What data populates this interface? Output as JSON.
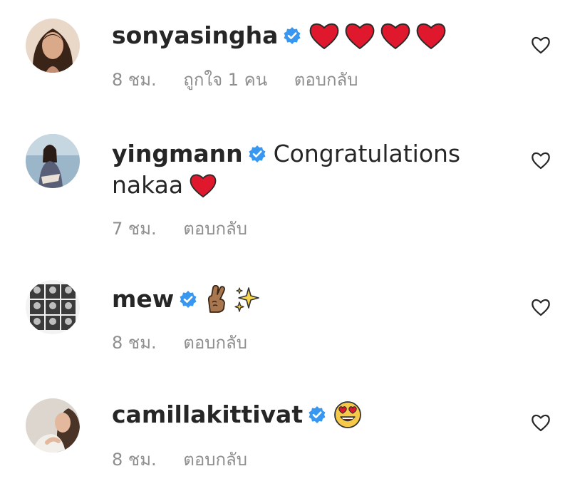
{
  "comments": [
    {
      "username": "sonyasingha",
      "text": "",
      "text_line2": "",
      "emoji_names": [
        "red-heart",
        "red-heart",
        "red-heart",
        "red-heart"
      ],
      "time": "8 ชม.",
      "likes": "ถูกใจ 1 คน",
      "reply": "ตอบกลับ"
    },
    {
      "username": "yingmann",
      "text": "Congratulations",
      "text_line2": "nakaa",
      "emoji_names": [
        "red-heart"
      ],
      "time": "7 ชม.",
      "likes": "",
      "reply": "ตอบกลับ"
    },
    {
      "username": "mew",
      "text": "",
      "text_line2": "",
      "emoji_names": [
        "crossed-fingers",
        "sparkles"
      ],
      "time": "8 ชม.",
      "likes": "",
      "reply": "ตอบกลับ"
    },
    {
      "username": "camillakittivat",
      "text": "",
      "text_line2": "",
      "emoji_names": [
        "heart-eyes-face"
      ],
      "time": "8 ชม.",
      "likes": "",
      "reply": "ตอบกลับ"
    }
  ],
  "colors": {
    "username": "#262626",
    "meta": "#8e8e8e",
    "verified": "#3897f0",
    "heart_emoji": "#e0182d"
  },
  "icons": {
    "verified": "verified-badge-icon",
    "like": "heart-outline-icon"
  }
}
